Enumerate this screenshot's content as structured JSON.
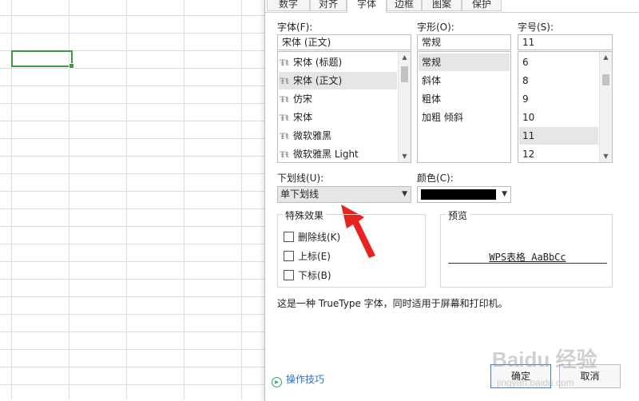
{
  "tabs": [
    {
      "label": "数字"
    },
    {
      "label": "对齐"
    },
    {
      "label": "字体"
    },
    {
      "label": "边框"
    },
    {
      "label": "图案"
    },
    {
      "label": "保护"
    }
  ],
  "font": {
    "label": "字体(F):",
    "value": "宋体 (正文)",
    "options": [
      "宋体 (标题)",
      "宋体 (正文)",
      "仿宋",
      "宋体",
      "微软雅黑",
      "微软雅黑 Light"
    ],
    "selected": "宋体 (正文)",
    "font_icon": "truetype-font-icon"
  },
  "style": {
    "label": "字形(O):",
    "value": "常规",
    "options": [
      "常规",
      "斜体",
      "粗体",
      "加粗 倾斜"
    ],
    "selected": "常规"
  },
  "size": {
    "label": "字号(S):",
    "value": "11",
    "options": [
      "6",
      "8",
      "9",
      "10",
      "11",
      "12"
    ],
    "selected": "11"
  },
  "underline": {
    "label": "下划线(U):",
    "value": "单下划线"
  },
  "color": {
    "label": "颜色(C):",
    "swatch": "#000000"
  },
  "effects": {
    "title": "特殊效果",
    "items": [
      {
        "label": "删除线(K)",
        "checked": false
      },
      {
        "label": "上标(E)",
        "checked": false
      },
      {
        "label": "下标(B)",
        "checked": false
      }
    ]
  },
  "preview": {
    "title": "预览",
    "text": "WPS表格  AaBbCc"
  },
  "description": "这是一种 TrueType 字体，同时适用于屏幕和打印机。",
  "tips": {
    "label": "操作技巧",
    "icon": "play-circle-icon"
  },
  "buttons": {
    "ok": "确定",
    "cancel": "取消"
  },
  "watermark_text": "Baidu 经验  jingyan.baidu.com",
  "annotation": {
    "color": "#e8231f"
  },
  "accent": {
    "cell_border": "#3f9a3f",
    "primary_button_border": "#3a7fd5"
  }
}
